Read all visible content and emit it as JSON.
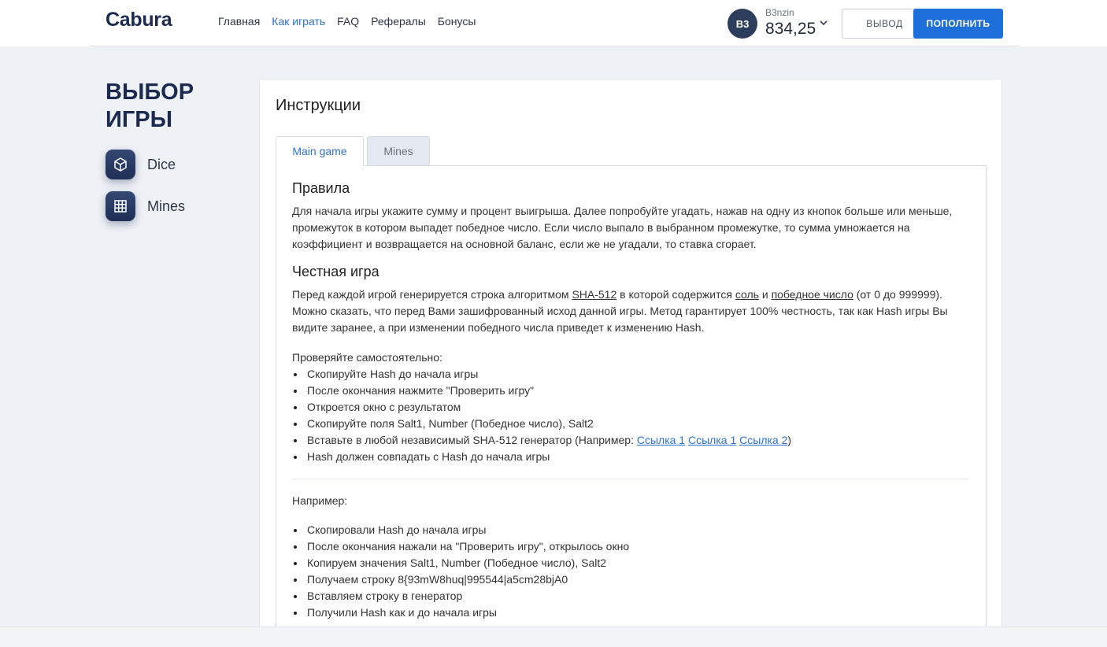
{
  "header": {
    "logo": "Cabura",
    "nav": [
      {
        "label": "Главная",
        "active": false
      },
      {
        "label": "Как играть",
        "active": true
      },
      {
        "label": "FAQ",
        "active": false
      },
      {
        "label": "Рефералы",
        "active": false
      },
      {
        "label": "Бонусы",
        "active": false
      }
    ],
    "user": {
      "initials": "B3",
      "name": "B3nzin",
      "balance": "834,25"
    },
    "withdraw_label": "ВЫВОД",
    "deposit_label": "ПОПОЛНИТЬ"
  },
  "sidebar": {
    "title": "ВЫБОР ИГРЫ",
    "games": [
      {
        "label": "Dice",
        "icon": "cube-icon"
      },
      {
        "label": "Mines",
        "icon": "grid-icon"
      }
    ]
  },
  "main": {
    "title": "Инструкции",
    "tabs": [
      {
        "label": "Main game",
        "active": true
      },
      {
        "label": "Mines",
        "active": false
      }
    ],
    "rules": {
      "heading": "Правила",
      "text": "Для начала игры укажите сумму и процент выигрыша. Далее попробуйте угадать, нажав на одну из кнопок больше или меньше, промежуток в котором выпадет победное число. Если число выпало в выбранном промежутке, то сумма умножается на коэффициент и возвращается на основной баланс, если же не угадали, то ставка сгорает."
    },
    "fair": {
      "heading": "Честная игра",
      "p1": "Перед каждой игрой генерируется строка алгоритмом ",
      "sha": "SHA-512",
      "p2": " в которой содержится ",
      "salt": "соль",
      "p3": " и ",
      "win": "победное число",
      "p4": " (от 0 до 999999). Можно сказать, что перед Вами зашифрованный исход данной игры. Метод гарантирует 100% честность, так как Hash игры Вы видите заранее, а при изменении победного числа приведет к изменению Hash."
    },
    "check": {
      "intro": "Проверяйте самостоятельно:",
      "items": [
        "Скопируйте Hash до начала игры",
        "После окончания нажмите \"Проверить игру\"",
        "Откроется окно с результатом",
        "Скопируйте поля Salt1, Number (Победное число), Salt2"
      ],
      "generator_text": "Вставьте в любой независимый SHA-512 генератор (Например: ",
      "links": [
        "Ссылка 1",
        "Ссылка 1",
        "Ссылка 2"
      ],
      "generator_close": ")",
      "last_item": "Hash должен совпадать с Hash до начала игры"
    },
    "example": {
      "intro": "Например:",
      "items": [
        "Скопировали Hash до начала игры",
        "После окончания нажали на \"Проверить игру\", открылось окно",
        "Копируем значения Salt1, Number (Победное число), Salt2",
        "Получаем строку 8{93mW8huq|995544|a5cm28bjA0",
        "Вставляем строку в генератор",
        "Получили Hash как и до начала игры"
      ]
    }
  }
}
